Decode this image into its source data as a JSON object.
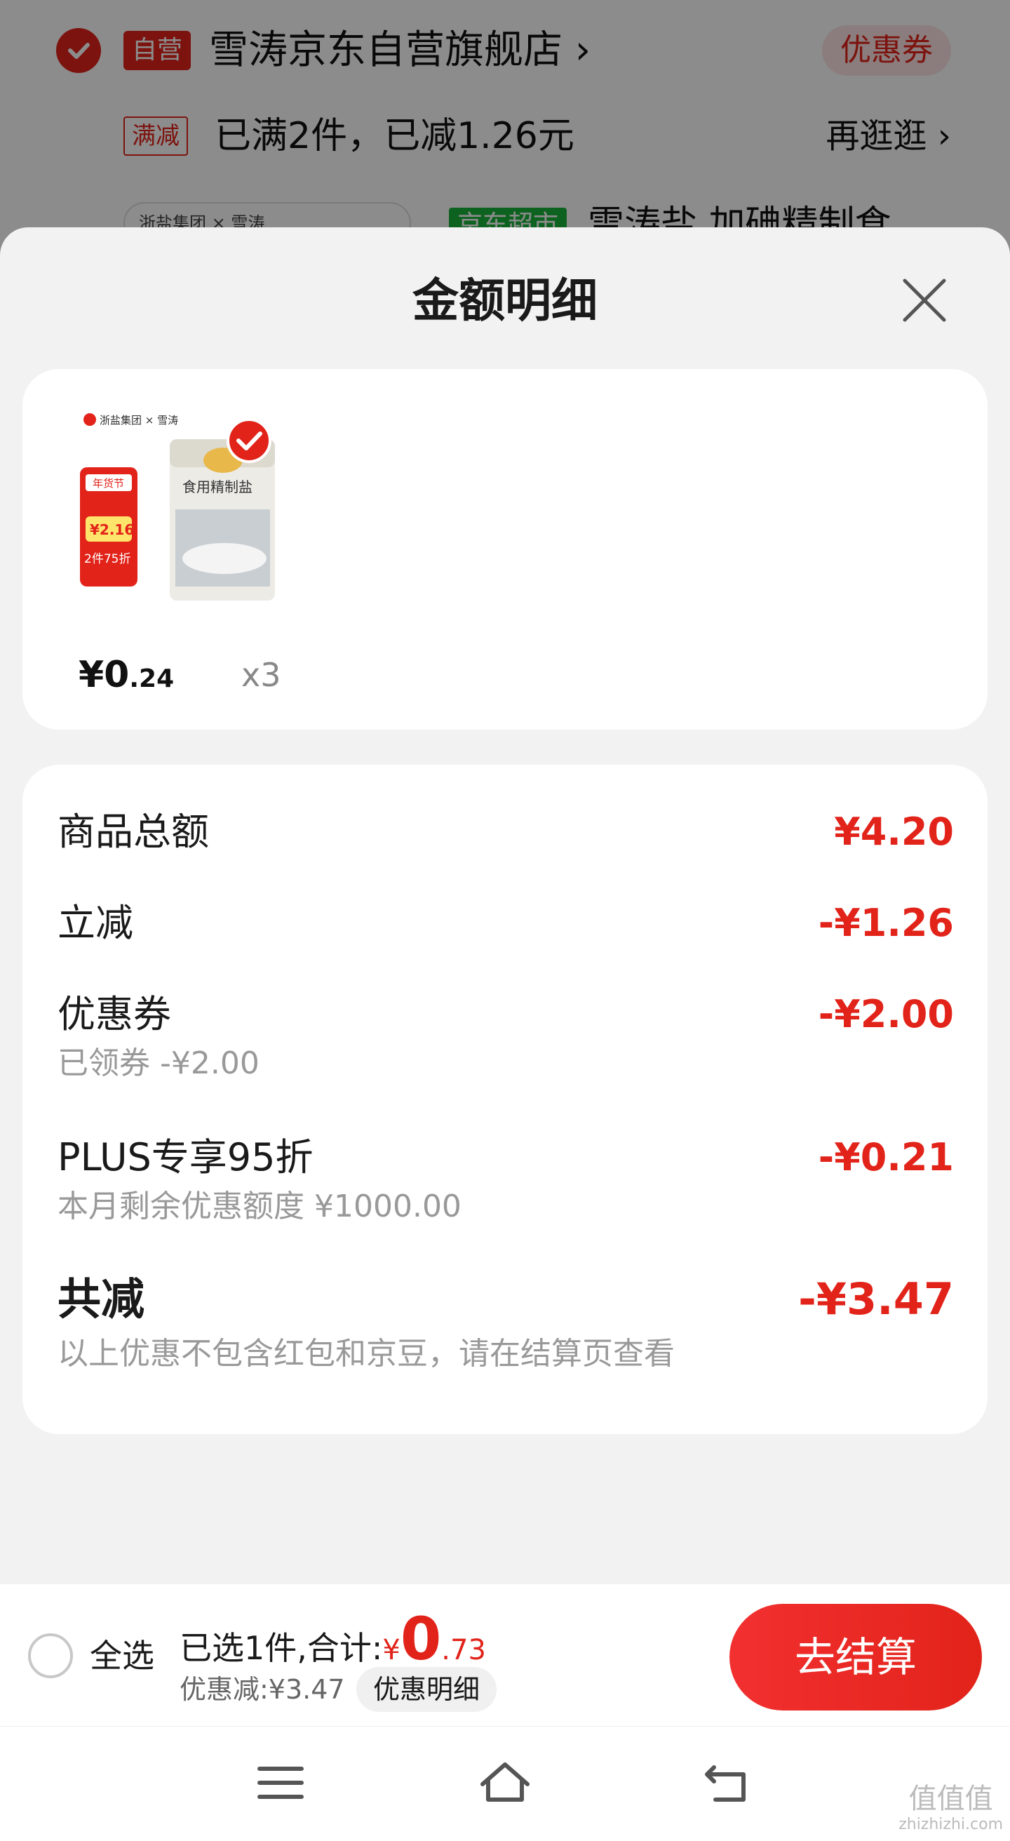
{
  "background": {
    "self_tag": "自营",
    "store_name": "雪涛京东自营旗舰店 ›",
    "coupon_label": "优惠券",
    "promo_tag": "满减",
    "promo_text": "已满2件，已减1.26元",
    "more_link": "再逛逛 ›",
    "brand_strip": "浙盐集团 × 雪涛",
    "jd_tag": "京东超市",
    "product_title": "雪涛盐 加碘精制食"
  },
  "sheet": {
    "title": "金额明细",
    "product": {
      "image_brand": "浙盐集团 × 雪涛",
      "image_badge_festival": "年货节",
      "image_price_tag": "¥2.16",
      "image_discount_tag": "2件75折",
      "image_bag_label": "食用精制盐",
      "price_int": "¥0",
      "price_dec": ".24",
      "quantity": "x3"
    },
    "details": {
      "subtotal_label": "商品总额",
      "subtotal_amount": "¥4.20",
      "instant_label": "立减",
      "instant_amount": "-¥1.26",
      "coupon_label": "优惠券",
      "coupon_amount": "-¥2.00",
      "coupon_sub": "已领券 -¥2.00",
      "plus_label": "PLUS专享95折",
      "plus_amount": "-¥0.21",
      "plus_sub": "本月剩余优惠额度 ¥1000.00",
      "total_label": "共减",
      "total_amount": "-¥3.47",
      "total_sub": "以上优惠不包含红包和京豆，请在结算页查看"
    }
  },
  "bottom_bar": {
    "select_all": "全选",
    "selected_prefix": "已选1件,合计:",
    "currency": "¥",
    "total_int": "0",
    "total_dec": ".73",
    "discount_text": "优惠减:¥3.47",
    "detail_button": "优惠明细",
    "checkout_button": "去结算"
  },
  "watermark": {
    "text": "值值值",
    "url": "zhizhizhi.com"
  },
  "colors": {
    "accent": "#e2231a",
    "muted_text": "#999999",
    "sheet_bg": "#f2f2f2"
  }
}
